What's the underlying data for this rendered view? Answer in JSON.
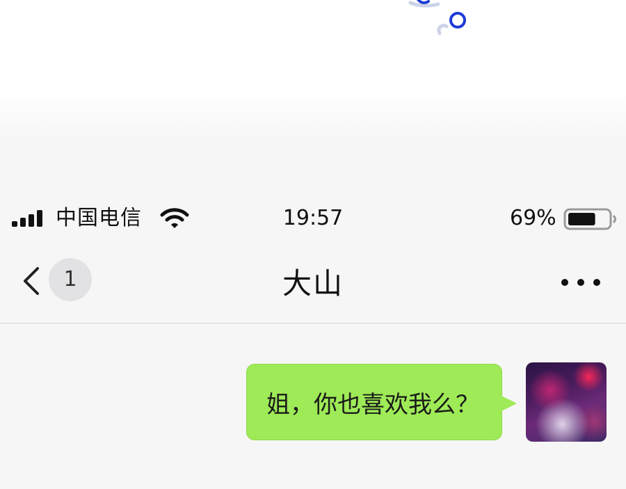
{
  "status_bar": {
    "carrier": "中国电信",
    "time": "19:57",
    "battery_percent": "69%",
    "battery_level": 0.69
  },
  "nav": {
    "title": "大山",
    "unread_count": "1",
    "back_icon": "chevron-left-icon",
    "more_icon": "ellipsis-icon"
  },
  "messages": [
    {
      "direction": "outgoing",
      "text": "姐，你也喜欢我么？"
    }
  ],
  "colors": {
    "bubble_outgoing": "#9eea57",
    "background": "#f6f6f6"
  }
}
